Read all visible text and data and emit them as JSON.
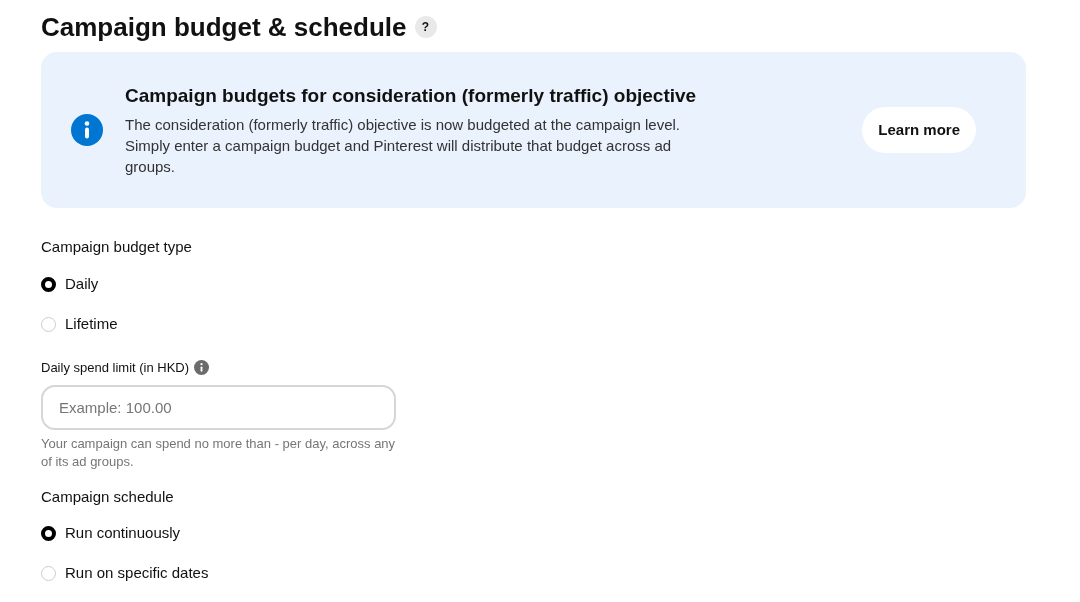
{
  "title": "Campaign budget & schedule",
  "help_mark": "?",
  "banner": {
    "heading": "Campaign budgets for consideration (formerly traffic) objective",
    "body": "The consideration (formerly traffic) objective is now budgeted at the campaign level. Simply enter a campaign budget and Pinterest will distribute that budget across ad groups.",
    "button": "Learn more"
  },
  "budget_type": {
    "label": "Campaign budget type",
    "options": [
      {
        "label": "Daily",
        "selected": true
      },
      {
        "label": "Lifetime",
        "selected": false
      }
    ]
  },
  "spend_limit": {
    "label": "Daily spend limit (in HKD)",
    "placeholder": "Example: 100.00",
    "hint": "Your campaign can spend no more than - per day, across any of its ad groups."
  },
  "schedule": {
    "label": "Campaign schedule",
    "options": [
      {
        "label": "Run continuously",
        "selected": true
      },
      {
        "label": "Run on specific dates",
        "selected": false
      }
    ]
  }
}
